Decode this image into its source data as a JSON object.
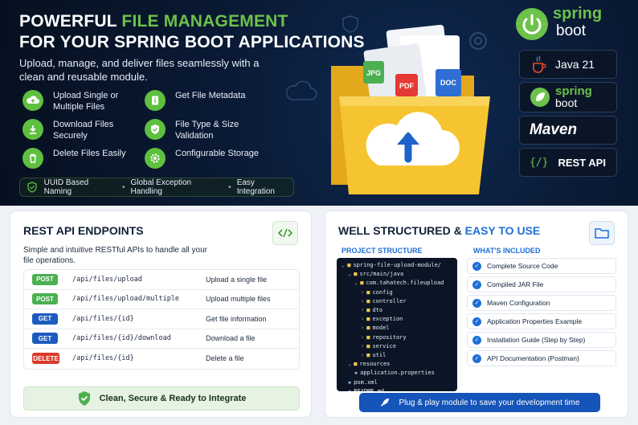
{
  "hero": {
    "title_line1_prefix": "POWERFUL ",
    "title_line1_green": "FILE MANAGEMENT",
    "title_line2": "FOR YOUR SPRING BOOT APPLICATIONS",
    "subtitle": "Upload, manage, and deliver files seamlessly with a clean and reusable module.",
    "features": [
      {
        "icon": "cloud-upload-icon",
        "label": "Upload Single or Multiple Files"
      },
      {
        "icon": "download-icon",
        "label": "Download Files Securely"
      },
      {
        "icon": "trash-icon",
        "label": "Delete Files Easily"
      },
      {
        "icon": "info-icon",
        "label": "Get File Metadata"
      },
      {
        "icon": "shield-check-icon",
        "label": "File Type & Size Validation"
      },
      {
        "icon": "gear-icon",
        "label": "Configurable Storage"
      }
    ],
    "pill": [
      "UUID Based Naming",
      "Global Exception Handling",
      "Easy Integration"
    ],
    "file_badges": [
      "JPG",
      "PDF",
      "DOC"
    ],
    "brands": {
      "spring_top": "spring",
      "boot_top": "boot",
      "java": "Java 21",
      "spring": "spring",
      "boot": "boot",
      "maven": "Maven",
      "rest": "REST API"
    }
  },
  "left_panel": {
    "title": "REST API ENDPOINTS",
    "description": "Simple and intuitive RESTful APIs to handle all your file operations.",
    "endpoints": [
      {
        "method": "POST",
        "path": "/api/files/upload",
        "desc": "Upload a single file"
      },
      {
        "method": "POST",
        "path": "/api/files/upload/multiple",
        "desc": "Upload multiple files"
      },
      {
        "method": "GET",
        "path": "/api/files/{id}",
        "desc": "Get file information"
      },
      {
        "method": "GET",
        "path": "/api/files/{id}/download",
        "desc": "Download a file"
      },
      {
        "method": "DELETE",
        "path": "/api/files/{id}",
        "desc": "Delete a file"
      }
    ],
    "footer": "Clean, Secure & Ready to Integrate"
  },
  "right_panel": {
    "title_prefix": "WELL STRUCTURED & ",
    "title_blue": "EASY TO USE",
    "structure_heading": "PROJECT STRUCTURE",
    "included_heading": "WHAT'S INCLUDED",
    "tree": [
      {
        "label": "spring-file-upload-module/",
        "kind": "folder",
        "depth": 0
      },
      {
        "label": "src/main/java",
        "kind": "folder",
        "depth": 1
      },
      {
        "label": "com.tahatech.fileupload",
        "kind": "folder",
        "depth": 2
      },
      {
        "label": "config",
        "kind": "folder",
        "depth": 3
      },
      {
        "label": "controller",
        "kind": "folder",
        "depth": 3
      },
      {
        "label": "dto",
        "kind": "folder",
        "depth": 3
      },
      {
        "label": "exception",
        "kind": "folder",
        "depth": 3
      },
      {
        "label": "model",
        "kind": "folder",
        "depth": 3
      },
      {
        "label": "repository",
        "kind": "folder",
        "depth": 3
      },
      {
        "label": "service",
        "kind": "folder",
        "depth": 3
      },
      {
        "label": "util",
        "kind": "folder",
        "depth": 3
      },
      {
        "label": "resources",
        "kind": "folder",
        "depth": 1
      },
      {
        "label": "application.properties",
        "kind": "file",
        "depth": 2
      },
      {
        "label": "pom.xml",
        "kind": "file",
        "depth": 1
      },
      {
        "label": "README.md",
        "kind": "file",
        "depth": 1
      }
    ],
    "included": [
      "Complete Source Code",
      "Compiled JAR File",
      "Maven Configuration",
      "Application Properties Example",
      "Installation Guide (Step by Step)",
      "API Documentation (Postman)"
    ],
    "footer": "Plug & play module to save your development time"
  },
  "colors": {
    "accent_green": "#6cc24a",
    "accent_blue": "#1d6fd6",
    "post": "#4caf50",
    "get": "#1d5bbf",
    "delete": "#d93a2b"
  }
}
